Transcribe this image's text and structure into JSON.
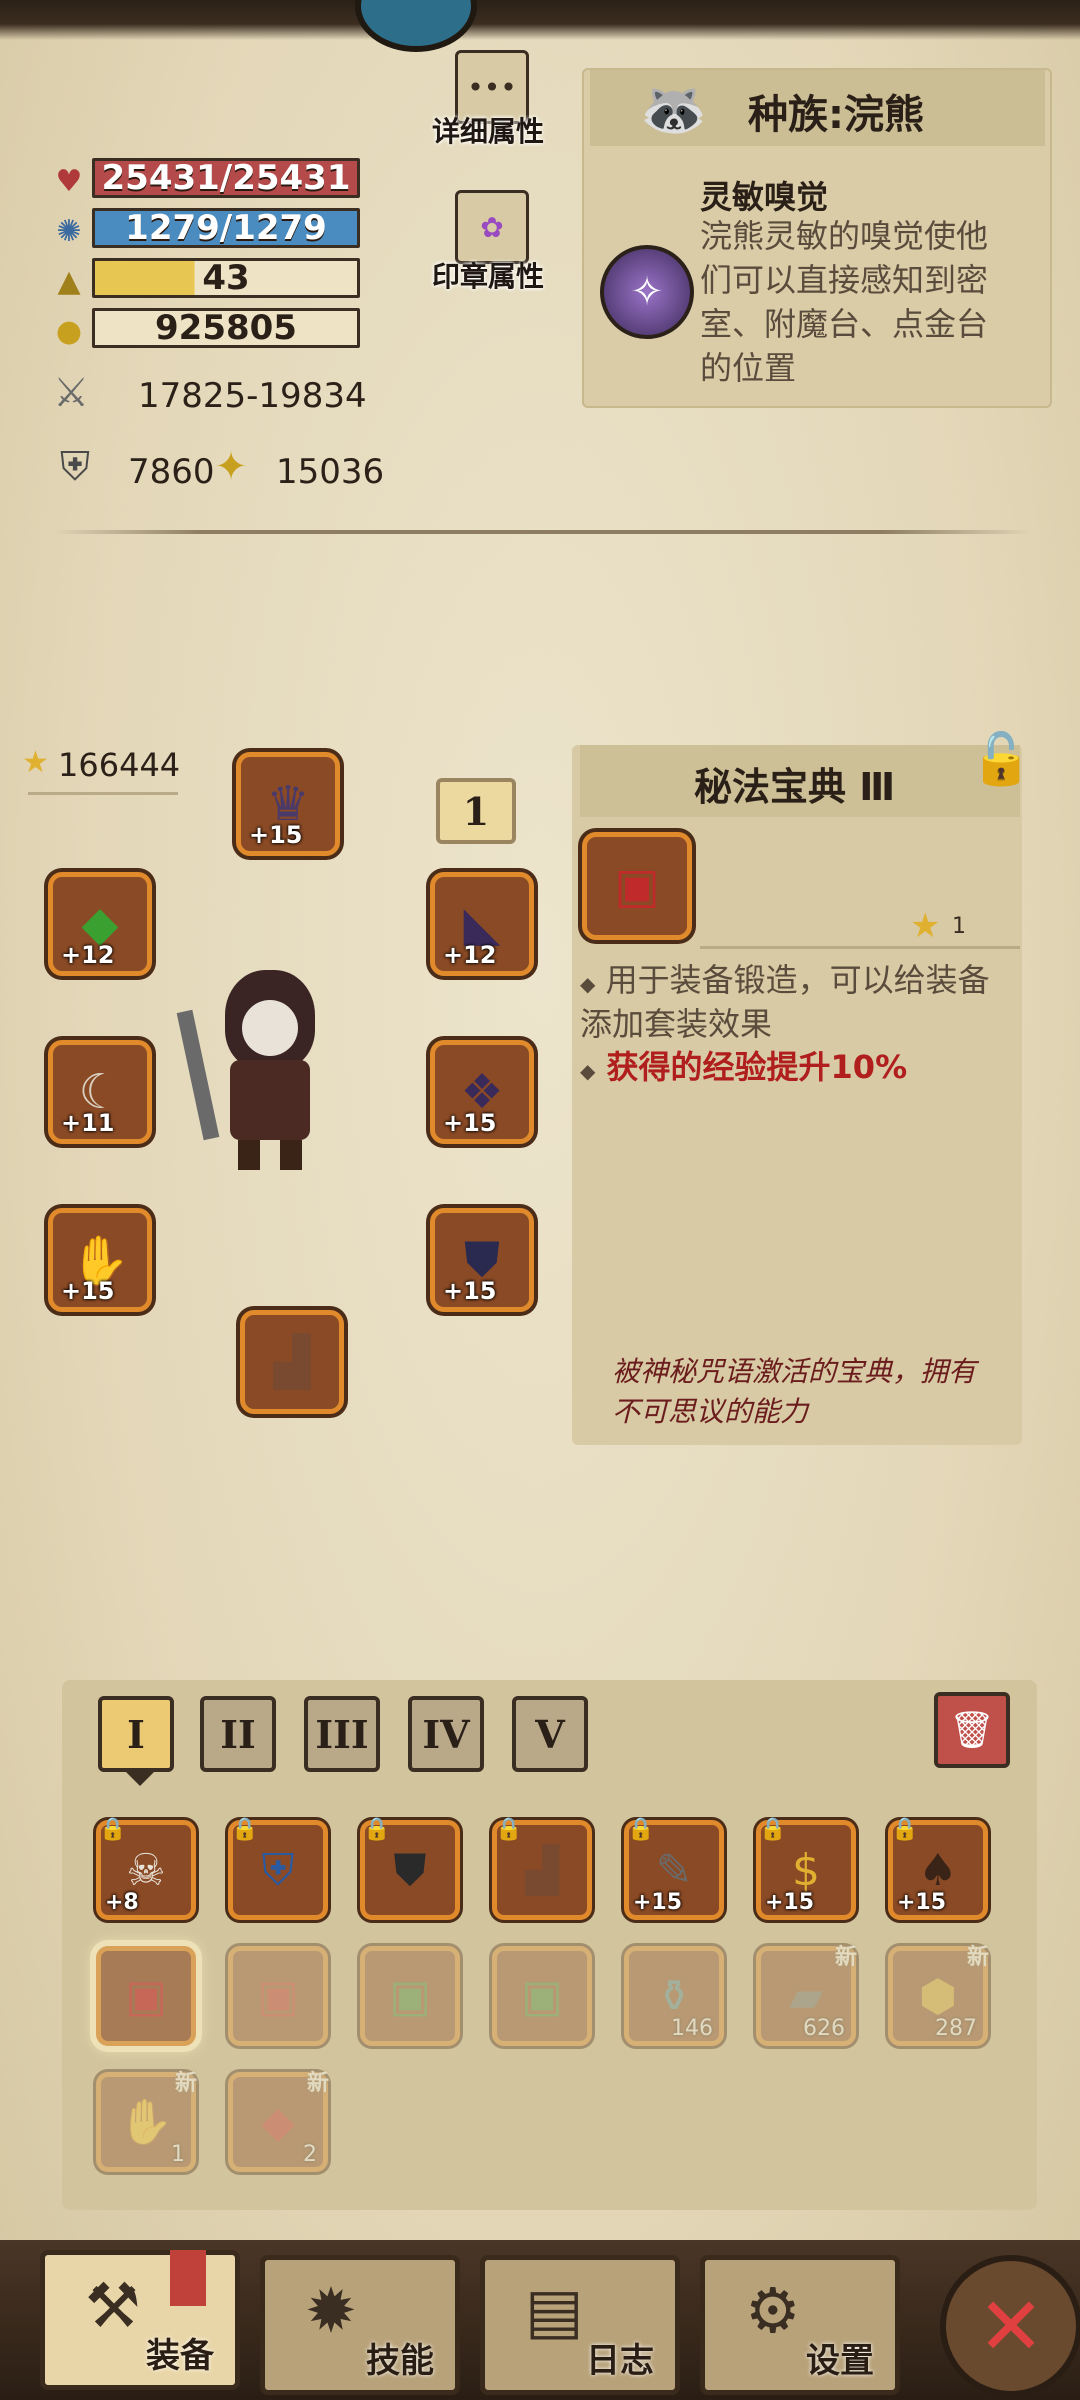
{
  "stats": {
    "hp": "25431/25431",
    "mp": "1279/1279",
    "level": "43",
    "gold": "925805",
    "attack": "17825-19834",
    "defense": "7860",
    "power": "15036"
  },
  "buttons": {
    "detail_attrs": "详细属性",
    "seal_attrs": "印章属性"
  },
  "race": {
    "title": "种族:浣熊",
    "skill_name": "灵敏嗅觉",
    "skill_desc": "浣熊灵敏的嗅觉使他们可以直接感知到密室、附魔台、点金台的位置"
  },
  "equipment": {
    "score": "166444",
    "set_badge": "1",
    "slots": [
      {
        "name": "helmet",
        "plus": "+15"
      },
      {
        "name": "emerald-gauntlet",
        "plus": "+12"
      },
      {
        "name": "dark-shoulder",
        "plus": "+12"
      },
      {
        "name": "curved-blade",
        "plus": "+11"
      },
      {
        "name": "dark-armor",
        "plus": "+15"
      },
      {
        "name": "purple-gloves",
        "plus": "+15"
      },
      {
        "name": "chest-plate",
        "plus": "+15"
      },
      {
        "name": "boots",
        "plus": ""
      }
    ]
  },
  "item": {
    "name": "秘法宝典 Ⅲ",
    "stars": "1",
    "bullet1": "用于装备锻造，可以给装备添加套装效果",
    "bullet2": "获得的经验提升10%",
    "flavor": "被神秘咒语激活的宝典，拥有不可思议的能力"
  },
  "inventory": {
    "tabs": [
      "I",
      "II",
      "III",
      "IV",
      "V"
    ],
    "active_tab": "I",
    "row1": [
      {
        "name": "skull-helm",
        "plus": "+8"
      },
      {
        "name": "rune-shield",
        "plus": ""
      },
      {
        "name": "black-armor",
        "plus": ""
      },
      {
        "name": "fur-boots",
        "plus": ""
      },
      {
        "name": "drill-weapon",
        "plus": "+15"
      },
      {
        "name": "money-bag",
        "plus": "+15"
      },
      {
        "name": "tribal-pauldron",
        "plus": "+15"
      }
    ],
    "row2": [
      {
        "name": "codex-selected",
        "count": "",
        "new": ""
      },
      {
        "name": "codex",
        "count": "",
        "new": ""
      },
      {
        "name": "green-codex",
        "count": "",
        "new": ""
      },
      {
        "name": "green-codex-2",
        "count": "",
        "new": ""
      },
      {
        "name": "potion",
        "count": "146",
        "new": ""
      },
      {
        "name": "iron-ingot",
        "count": "626",
        "new": "新"
      },
      {
        "name": "gold-ore",
        "count": "287",
        "new": "新"
      }
    ],
    "row3": [
      {
        "name": "glove-material",
        "count": "1",
        "new": "新"
      },
      {
        "name": "red-gem",
        "count": "2",
        "new": "新"
      }
    ]
  },
  "nav": {
    "equip": "装备",
    "skills": "技能",
    "log": "日志",
    "settings": "设置"
  },
  "colors": {
    "hp_bar": "#b54a4b",
    "mp_bar": "#4a8cc0",
    "level_bar": "#e7c751",
    "slot_border": "#e08a2c",
    "accent_red": "#b01e1e"
  }
}
